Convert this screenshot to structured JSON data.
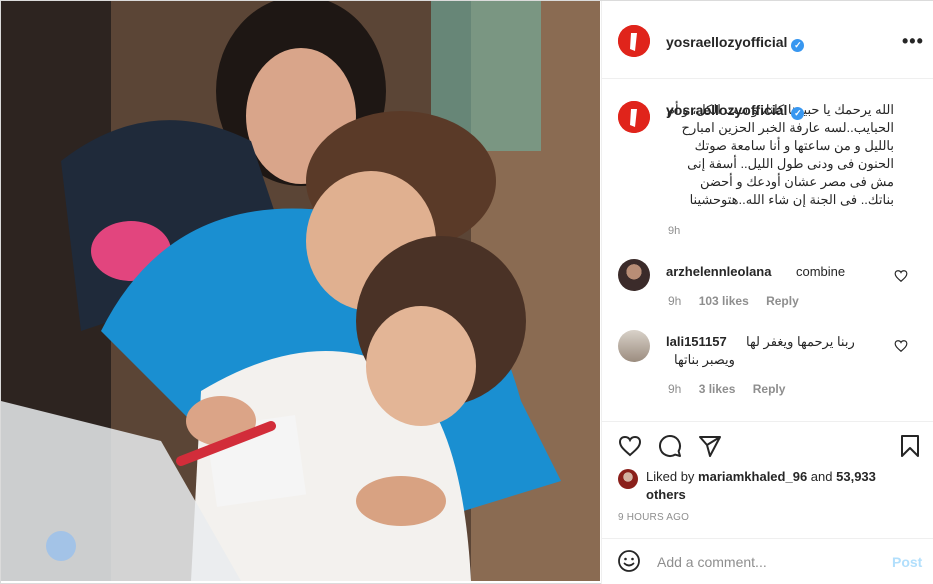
{
  "post": {
    "username": "yosraellozyofficial",
    "verified_mark": "✓",
    "more_label": "•••"
  },
  "caption": {
    "username": "yosraellozyofficial",
    "text": "الله يرحمك يا حبيبتنا كلنا، و ست الكل، و أم الحبايب..لسه عارفة الخبر الحزين امبارح بالليل و من ساعتها و أنا سامعة صوتك الحنون فى ودنى طول الليل.. أسفة إنى مش فى مصر عشان أودعك و أحضن بناتك.. فى الجنة إن شاء الله..هتوحشينا",
    "time": "9h"
  },
  "comments": [
    {
      "username": "arzhelennleolana",
      "text": "combine",
      "time": "9h",
      "likes": "103 likes",
      "reply": "Reply"
    },
    {
      "username": "lali151157",
      "text_line1": "ربنا يرحمها ويغفر لها",
      "text_line2": "ويصبر بناتها",
      "time": "9h",
      "likes": "3 likes",
      "reply": "Reply"
    }
  ],
  "liked_by": {
    "prefix": "Liked by",
    "user": "mariamkhaled_96",
    "and": "and",
    "others": "53,933 others"
  },
  "timestamp": "9 HOURS AGO",
  "add_comment": {
    "placeholder": "Add a comment...",
    "post_label": "Post"
  },
  "icons": [
    "heart-icon",
    "comment-icon",
    "share-icon",
    "bookmark-icon",
    "emoji-icon",
    "more-icon",
    "verified-icon"
  ],
  "colors": {
    "verified": "#3897f0",
    "brand_avatar": "#e0241b",
    "post_disabled": "#b2dffc",
    "muted": "#8e8e8e"
  }
}
